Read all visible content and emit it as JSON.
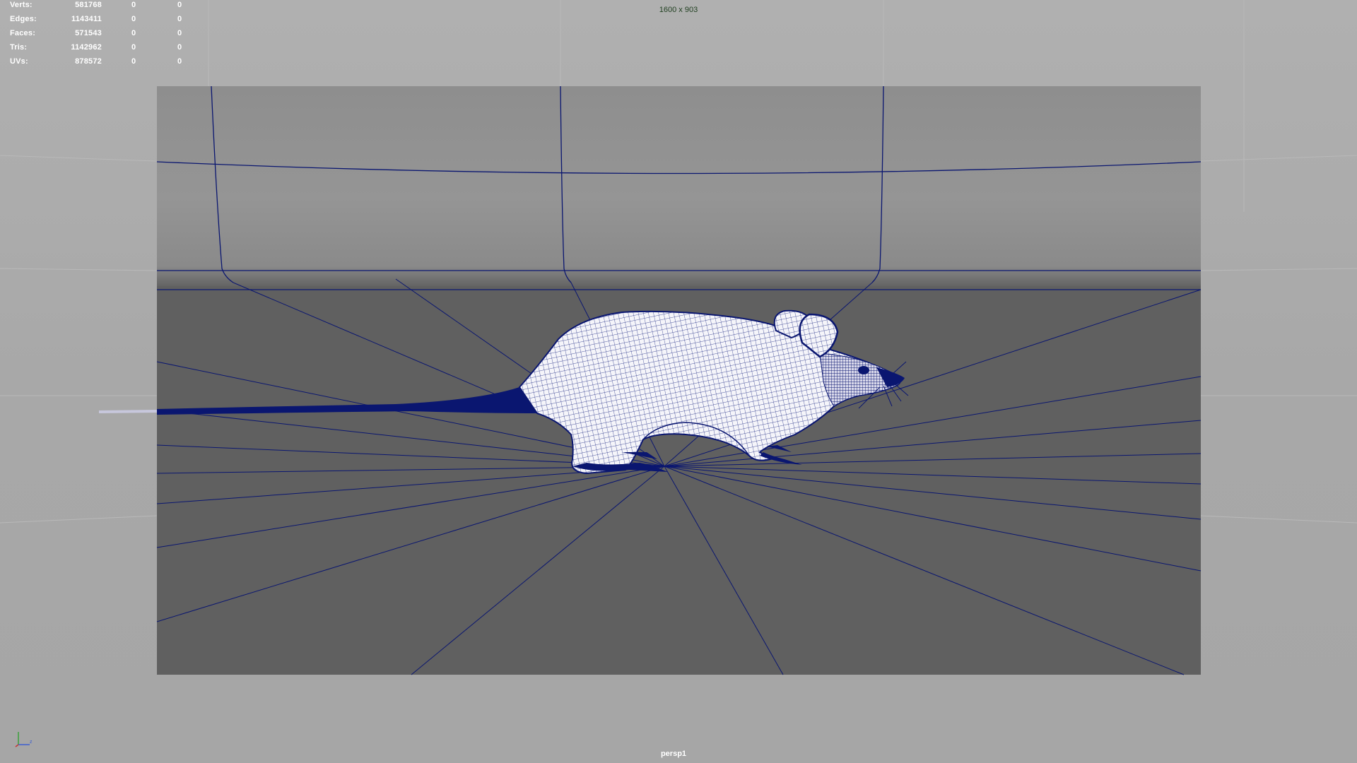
{
  "hud": {
    "stats": [
      {
        "label": "Verts:",
        "total": "581768",
        "selected": "0",
        "component": "0"
      },
      {
        "label": "Edges:",
        "total": "1143411",
        "selected": "0",
        "component": "0"
      },
      {
        "label": "Faces:",
        "total": "571543",
        "selected": "0",
        "component": "0"
      },
      {
        "label": "Tris:",
        "total": "1142962",
        "selected": "0",
        "component": "0"
      },
      {
        "label": "UVs:",
        "total": "878572",
        "selected": "0",
        "component": "0"
      }
    ],
    "resolution": "1600 x 903",
    "camera": "persp1"
  },
  "colors": {
    "wireframe": "#0a1670",
    "backdrop_top": "#8e8e8e",
    "floor": "#606060",
    "viewport_bg": "#a9a9a9",
    "mesh_fill": "#f4f4f8"
  },
  "icons": {
    "axis": "xyz-axis-gizmo-icon"
  }
}
